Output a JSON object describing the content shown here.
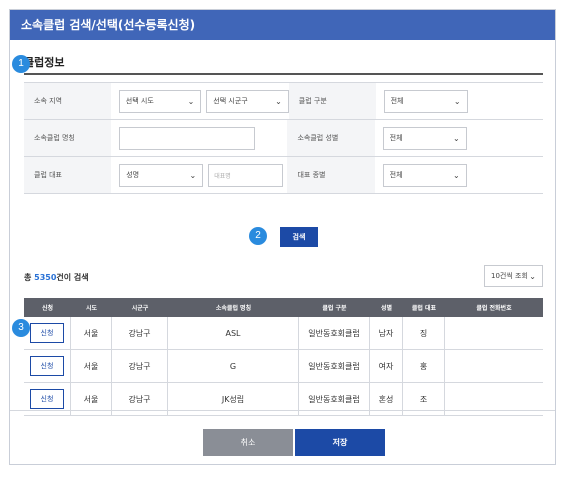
{
  "dialog": {
    "title": "소속클럽 검색/선택(선수등록신청)"
  },
  "badges": {
    "one": "1",
    "two": "2",
    "three": "3"
  },
  "section": {
    "title": "클럽정보"
  },
  "form": {
    "region_label": "소속 지역",
    "sido_value": "선택 시도",
    "sigungu_value": "선택 시군구",
    "club_type_label": "클럽 구분",
    "club_type_value": "전체",
    "club_name_label": "소속클럽 명칭",
    "club_name_value": "",
    "club_gender_label": "소속클럽 성별",
    "club_gender_value": "전체",
    "rep_label": "클럽 대표",
    "rep_select_value": "성명",
    "rep_input_placeholder": "대표명",
    "rep_event_label": "대표 종별",
    "rep_event_value": "전체"
  },
  "search_button": "검색",
  "results": {
    "prefix": "총 ",
    "count": "5350",
    "suffix": "건이 검색"
  },
  "per_page": "10건씩 조회",
  "table": {
    "headers": [
      "신청",
      "시도",
      "시군구",
      "소속클럽 명칭",
      "클럽 구분",
      "성별",
      "클럽 대표",
      "클럽 전화번호"
    ],
    "rows": [
      {
        "apply": "신청",
        "sido": "서울",
        "sigungu": "강남구",
        "name": "ASL",
        "type": "일반동호회클럽",
        "gender": "남자",
        "rep": "징",
        "phone": ""
      },
      {
        "apply": "신청",
        "sido": "서울",
        "sigungu": "강남구",
        "name": "G",
        "type": "일반동호회클럽",
        "gender": "여자",
        "rep": "홍",
        "phone": ""
      },
      {
        "apply": "신청",
        "sido": "서울",
        "sigungu": "강남구",
        "name": "JK성립",
        "type": "일반동호회클럽",
        "gender": "혼성",
        "rep": "조",
        "phone": ""
      }
    ]
  },
  "footer": {
    "cancel": "취소",
    "save": "저장"
  },
  "colors": {
    "title_bar": "#4066b8",
    "primary": "#1c4aa6",
    "badge": "#2a8bde",
    "header": "#5d6069",
    "cancel": "#8a8e96"
  }
}
